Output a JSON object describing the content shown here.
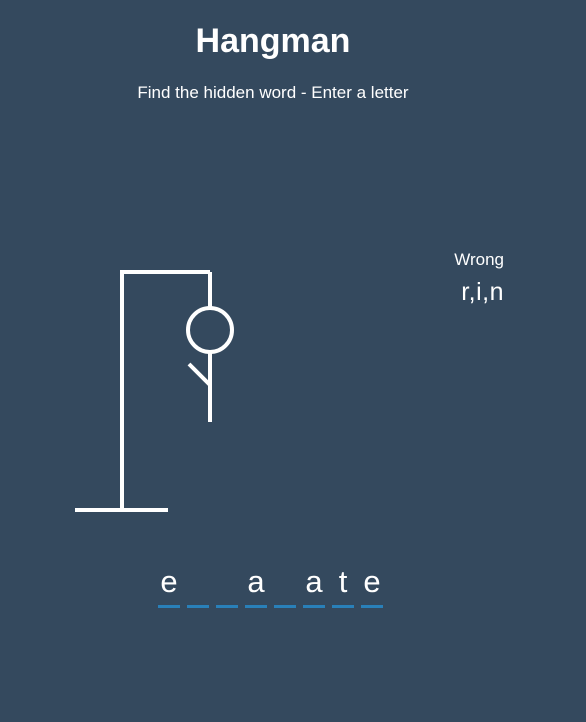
{
  "header": {
    "title": "Hangman",
    "subtitle": "Find the hidden word - Enter a letter"
  },
  "wrong": {
    "label": "Wrong",
    "letters": "r,i,n"
  },
  "word": {
    "letters": [
      "e",
      "",
      "",
      "a",
      "",
      "a",
      "t",
      "e"
    ]
  },
  "colors": {
    "background": "#34495e",
    "text": "#ffffff",
    "underline": "#2980b9"
  },
  "figure": {
    "parts_shown": [
      "gallows-base",
      "gallows-pole",
      "gallows-top",
      "rope",
      "head",
      "body",
      "left-arm"
    ]
  }
}
